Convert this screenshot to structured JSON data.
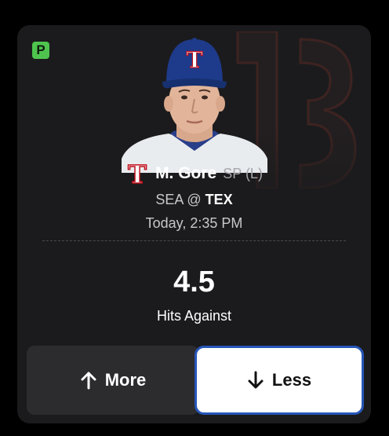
{
  "badge": {
    "letter": "P",
    "color": "#4ec44e"
  },
  "player": {
    "name": "M. Gore",
    "position": "SP (L)",
    "team_logo_icon": "rangers-t-logo-icon",
    "photo": "player-headshot"
  },
  "matchup": {
    "away": "SEA",
    "separator": "@",
    "home": "TEX"
  },
  "game_time": "Today, 2:35 PM",
  "projection": {
    "value": "4.5",
    "stat": "Hits Against"
  },
  "actions": {
    "more_label": "More",
    "more_icon": "arrow-up-icon",
    "less_label": "Less",
    "less_icon": "arrow-down-icon",
    "selected": "less",
    "accent": "#2656b8"
  }
}
